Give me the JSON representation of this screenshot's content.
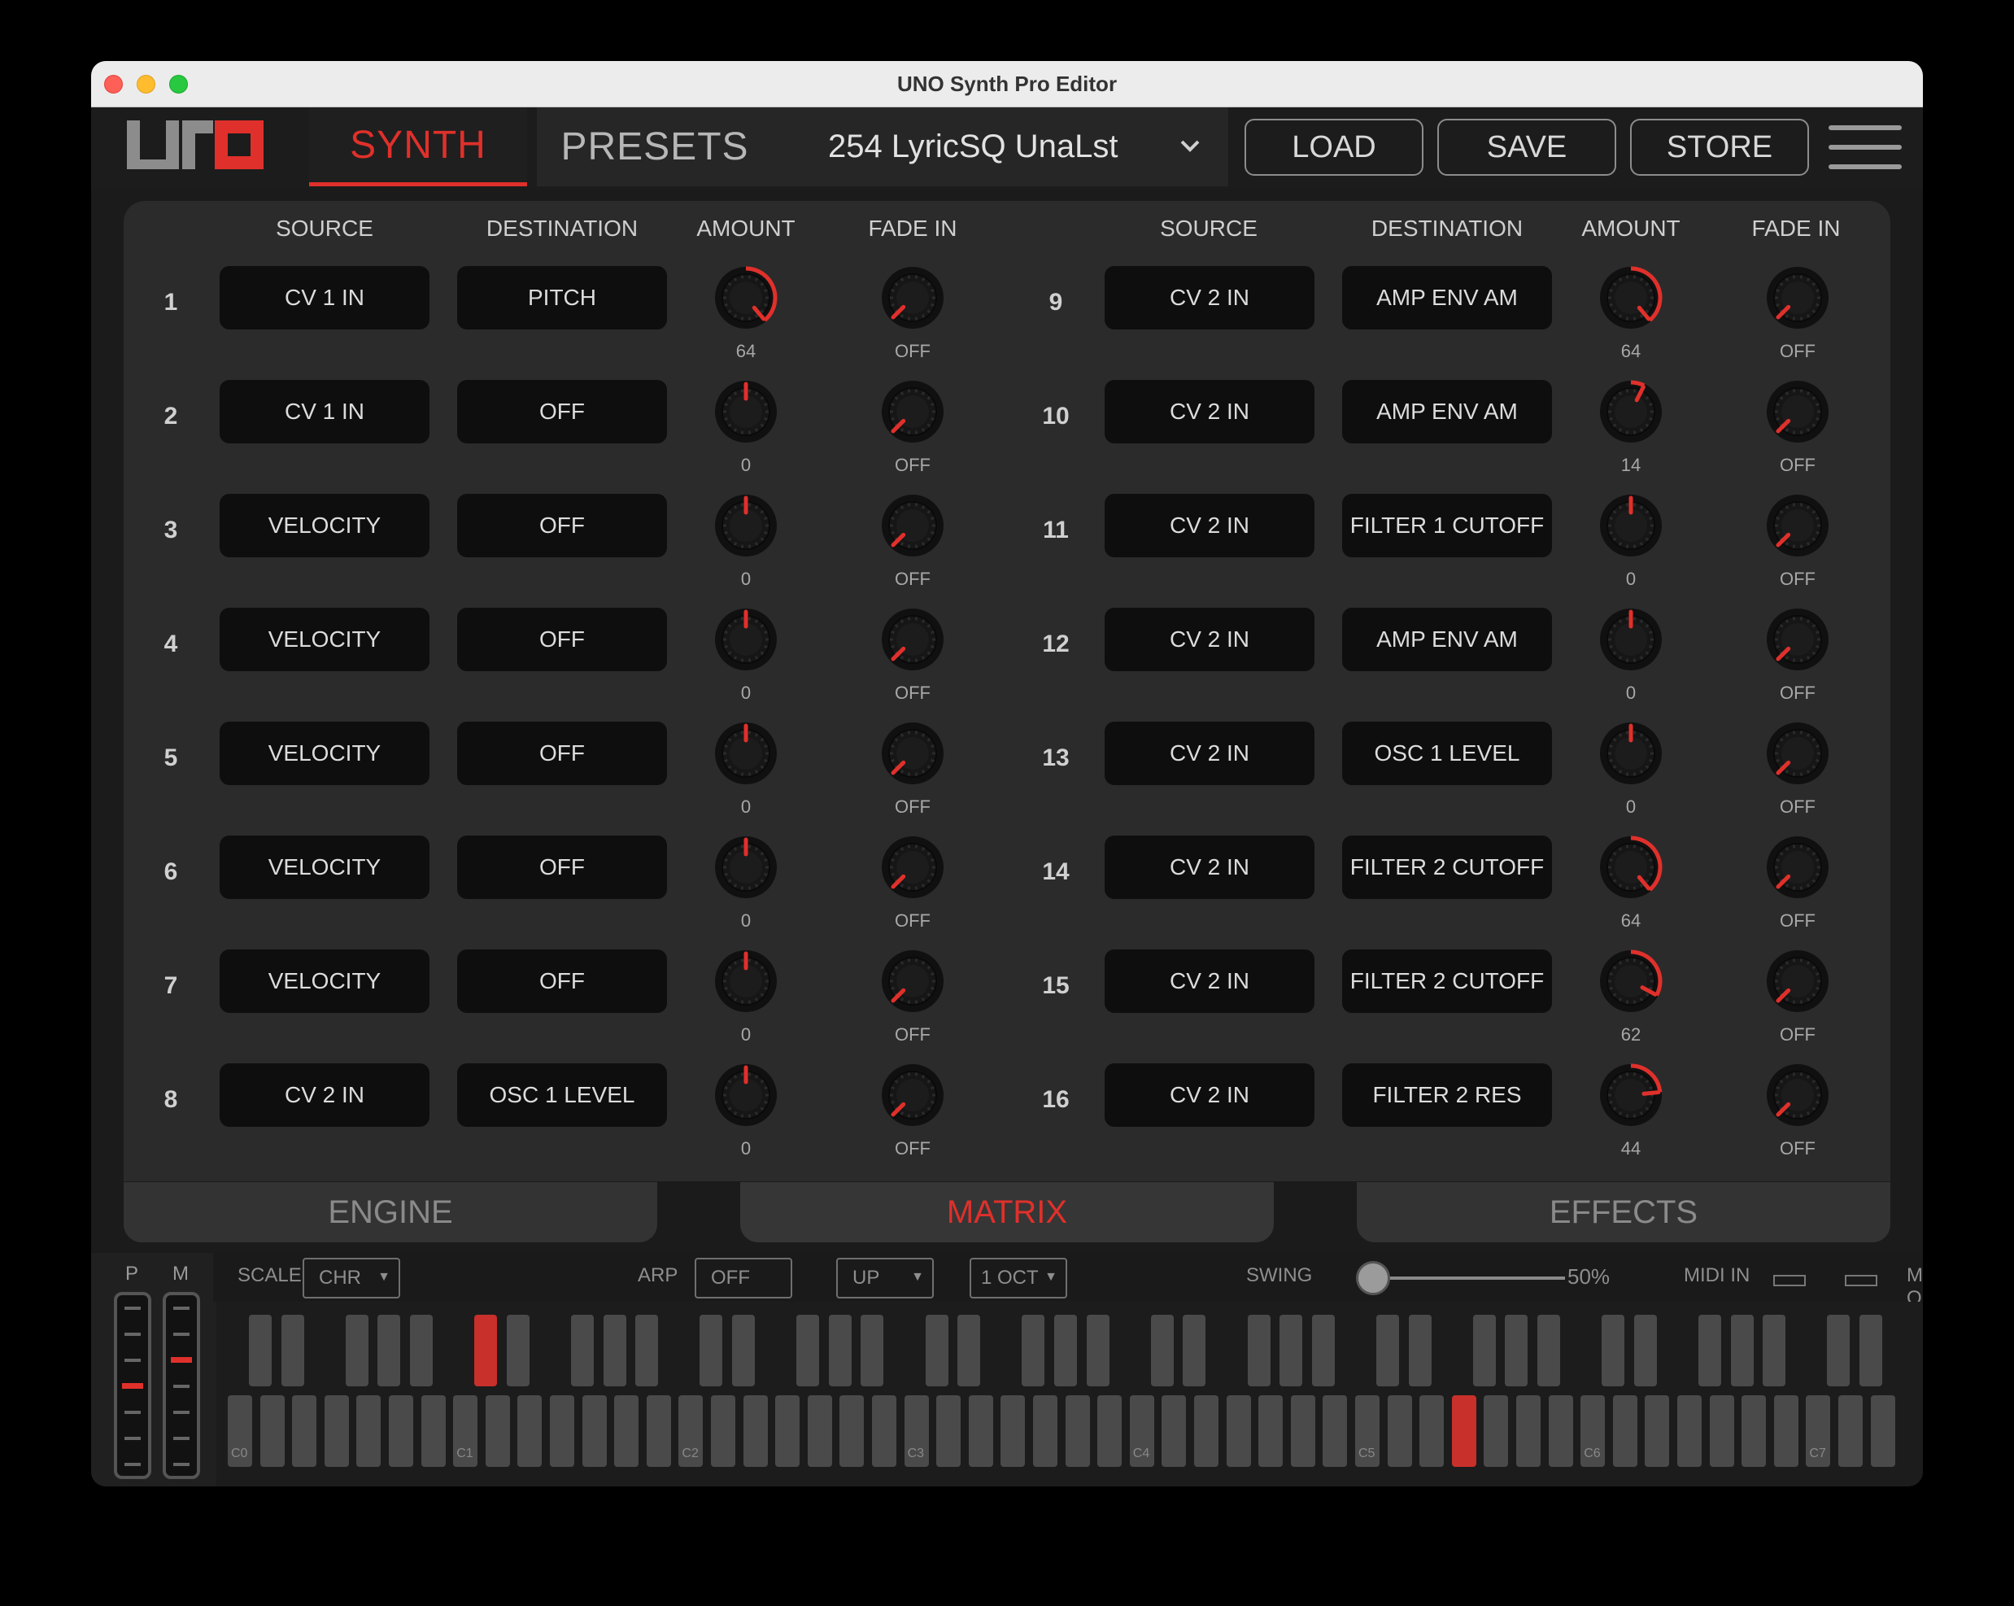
{
  "window": {
    "title": "UNO Synth Pro Editor"
  },
  "header": {
    "tabs": [
      "SYNTH",
      "PRESETS"
    ],
    "active_tab": "SYNTH",
    "preset": "254 LyricSQ UnaLst",
    "buttons": {
      "load": "LOAD",
      "save": "SAVE",
      "store": "STORE"
    }
  },
  "matrix": {
    "headers": {
      "source": "SOURCE",
      "destination": "DESTINATION",
      "amount": "AMOUNT",
      "fade_in": "FADE IN"
    },
    "rows": [
      {
        "num": "1",
        "source": "CV 1 IN",
        "destination": "PITCH",
        "amount": "64",
        "fade": "OFF"
      },
      {
        "num": "2",
        "source": "CV 1 IN",
        "destination": "OFF",
        "amount": "0",
        "fade": "OFF"
      },
      {
        "num": "3",
        "source": "VELOCITY",
        "destination": "OFF",
        "amount": "0",
        "fade": "OFF"
      },
      {
        "num": "4",
        "source": "VELOCITY",
        "destination": "OFF",
        "amount": "0",
        "fade": "OFF"
      },
      {
        "num": "5",
        "source": "VELOCITY",
        "destination": "OFF",
        "amount": "0",
        "fade": "OFF"
      },
      {
        "num": "6",
        "source": "VELOCITY",
        "destination": "OFF",
        "amount": "0",
        "fade": "OFF"
      },
      {
        "num": "7",
        "source": "VELOCITY",
        "destination": "OFF",
        "amount": "0",
        "fade": "OFF"
      },
      {
        "num": "8",
        "source": "CV 2 IN",
        "destination": "OSC 1 LEVEL",
        "amount": "0",
        "fade": "OFF"
      },
      {
        "num": "9",
        "source": "CV 2 IN",
        "destination": "AMP ENV AM",
        "amount": "64",
        "fade": "OFF"
      },
      {
        "num": "10",
        "source": "CV 2 IN",
        "destination": "AMP ENV AM",
        "amount": "14",
        "fade": "OFF"
      },
      {
        "num": "11",
        "source": "CV 2 IN",
        "destination": "FILTER 1 CUTOFF",
        "amount": "0",
        "fade": "OFF"
      },
      {
        "num": "12",
        "source": "CV 2 IN",
        "destination": "AMP ENV AM",
        "amount": "0",
        "fade": "OFF"
      },
      {
        "num": "13",
        "source": "CV 2 IN",
        "destination": "OSC 1 LEVEL",
        "amount": "0",
        "fade": "OFF"
      },
      {
        "num": "14",
        "source": "CV 2 IN",
        "destination": "FILTER 2 CUTOFF",
        "amount": "64",
        "fade": "OFF"
      },
      {
        "num": "15",
        "source": "CV 2 IN",
        "destination": "FILTER 2 CUTOFF",
        "amount": "62",
        "fade": "OFF"
      },
      {
        "num": "16",
        "source": "CV 2 IN",
        "destination": "FILTER 2 RES",
        "amount": "44",
        "fade": "OFF"
      }
    ]
  },
  "bottom_tabs": {
    "engine": "ENGINE",
    "matrix": "MATRIX",
    "effects": "EFFECTS",
    "active": "MATRIX"
  },
  "keyboard": {
    "wheels": {
      "pitch": "P",
      "mod": "M"
    },
    "scale_label": "SCALE",
    "scale_value": "CHR",
    "arp_label": "ARP",
    "arp_value": "OFF",
    "direction_value": "UP",
    "octave_value": "1 OCT",
    "swing_label": "SWING",
    "swing_value": "50%",
    "midi_in": "MIDI IN",
    "midi_out": "MIDI OUT",
    "octave_labels": [
      "C0",
      "C1",
      "C2",
      "C3",
      "C4",
      "C5",
      "C6",
      "C7"
    ],
    "pressed_keys": [
      "C#1",
      "G5"
    ]
  },
  "colors": {
    "accent": "#e0302b",
    "panel": "#2b2b2b",
    "pill": "#0e0e0e"
  },
  "icons": [
    "chevron-down-icon",
    "hamburger-menu-icon",
    "uno-logo"
  ]
}
